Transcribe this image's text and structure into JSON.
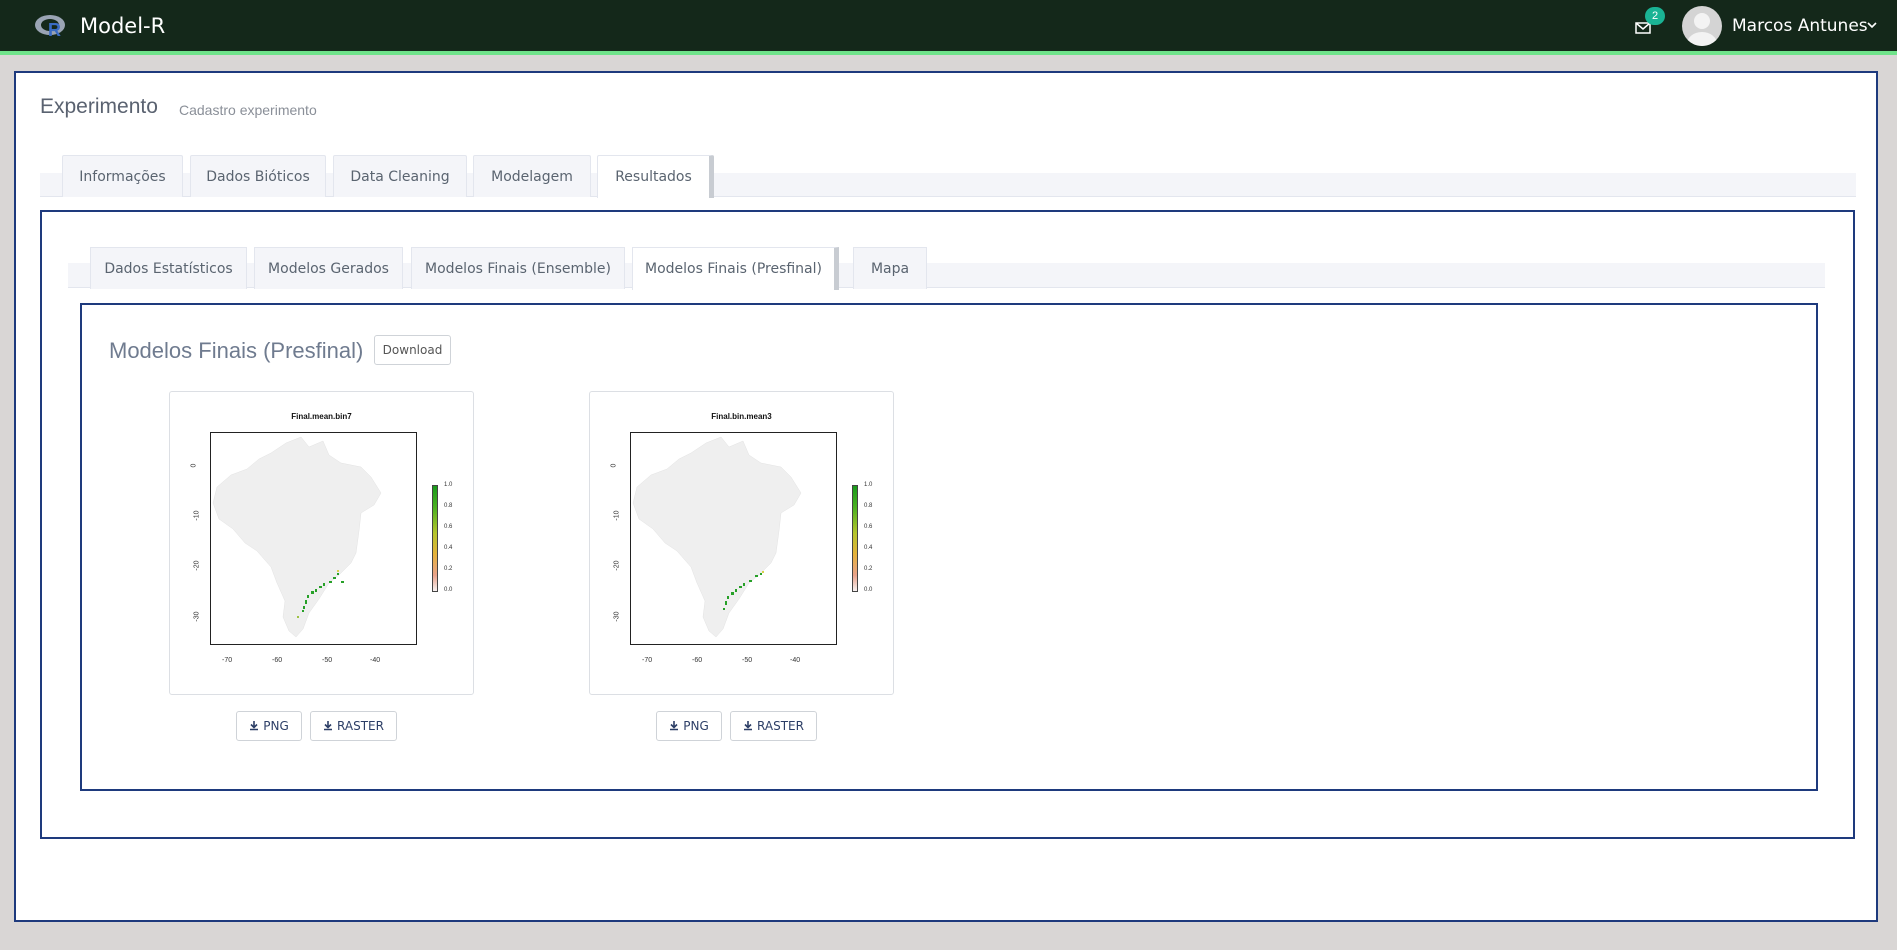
{
  "app": {
    "brand": "Model-R",
    "notifications_count": "2",
    "user_name": "Marcos Antunes"
  },
  "page": {
    "title": "Experimento",
    "subtitle": "Cadastro experimento"
  },
  "main_tabs": [
    {
      "label": "Informações"
    },
    {
      "label": "Dados Bióticos"
    },
    {
      "label": "Data Cleaning"
    },
    {
      "label": "Modelagem"
    },
    {
      "label": "Resultados",
      "active": true
    }
  ],
  "result_tabs": [
    {
      "label": "Dados Estatísticos"
    },
    {
      "label": "Modelos Gerados"
    },
    {
      "label": "Modelos Finais (Ensemble)"
    },
    {
      "label": "Modelos Finais (Presfinal)",
      "active": true
    },
    {
      "label": "Mapa"
    }
  ],
  "results": {
    "title": "Modelos Finais (Presfinal)",
    "download_label": "Download",
    "maps": [
      {
        "title": "Final.mean.bin7",
        "png_label": "PNG",
        "raster_label": "RASTER"
      },
      {
        "title": "Final.bin.mean3",
        "png_label": "PNG",
        "raster_label": "RASTER"
      }
    ],
    "axis": {
      "y_ticks": [
        "0",
        "-10",
        "-20",
        "-30"
      ],
      "x_ticks": [
        "-70",
        "-60",
        "-50",
        "-40"
      ],
      "legend_ticks": [
        "1.0",
        "0.8",
        "0.6",
        "0.4",
        "0.2",
        "0.0"
      ]
    }
  },
  "colors": {
    "navbar": "#14281a",
    "navbar_accent": "#6fe38a",
    "panel_border": "#1e3a7d",
    "badge": "#1ab394"
  }
}
